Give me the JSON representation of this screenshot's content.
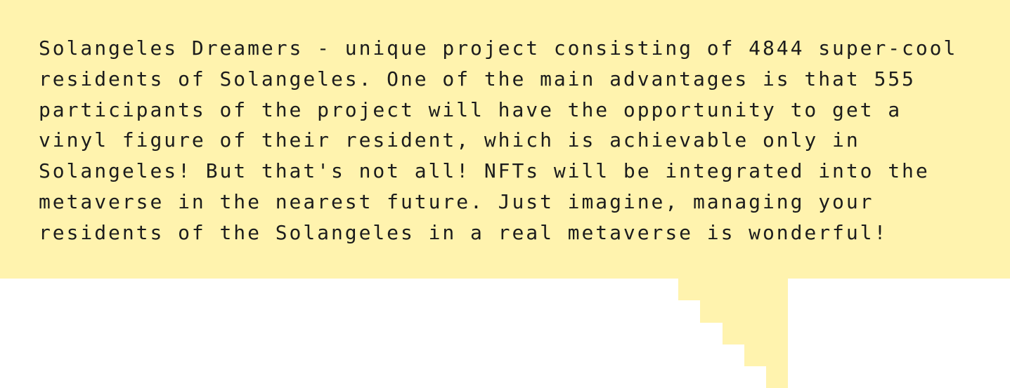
{
  "bubble": {
    "background_color": "#FFF3AE",
    "text": "Solangeles Dreamers - unique project consisting of 4844 super-cool\nresidents of Solangeles. One of the main advantages is that 555\nparticipants of the project will have the opportunity to get a\nvinyl figure of their resident, which is achievable only in\nSolangeles! But that's not all! NFTs will be integrated into the\nmetaverse in the nearest future. Just imagine, managing your\nresidents of the Solangeles in a real metaverse is wonderful!"
  }
}
